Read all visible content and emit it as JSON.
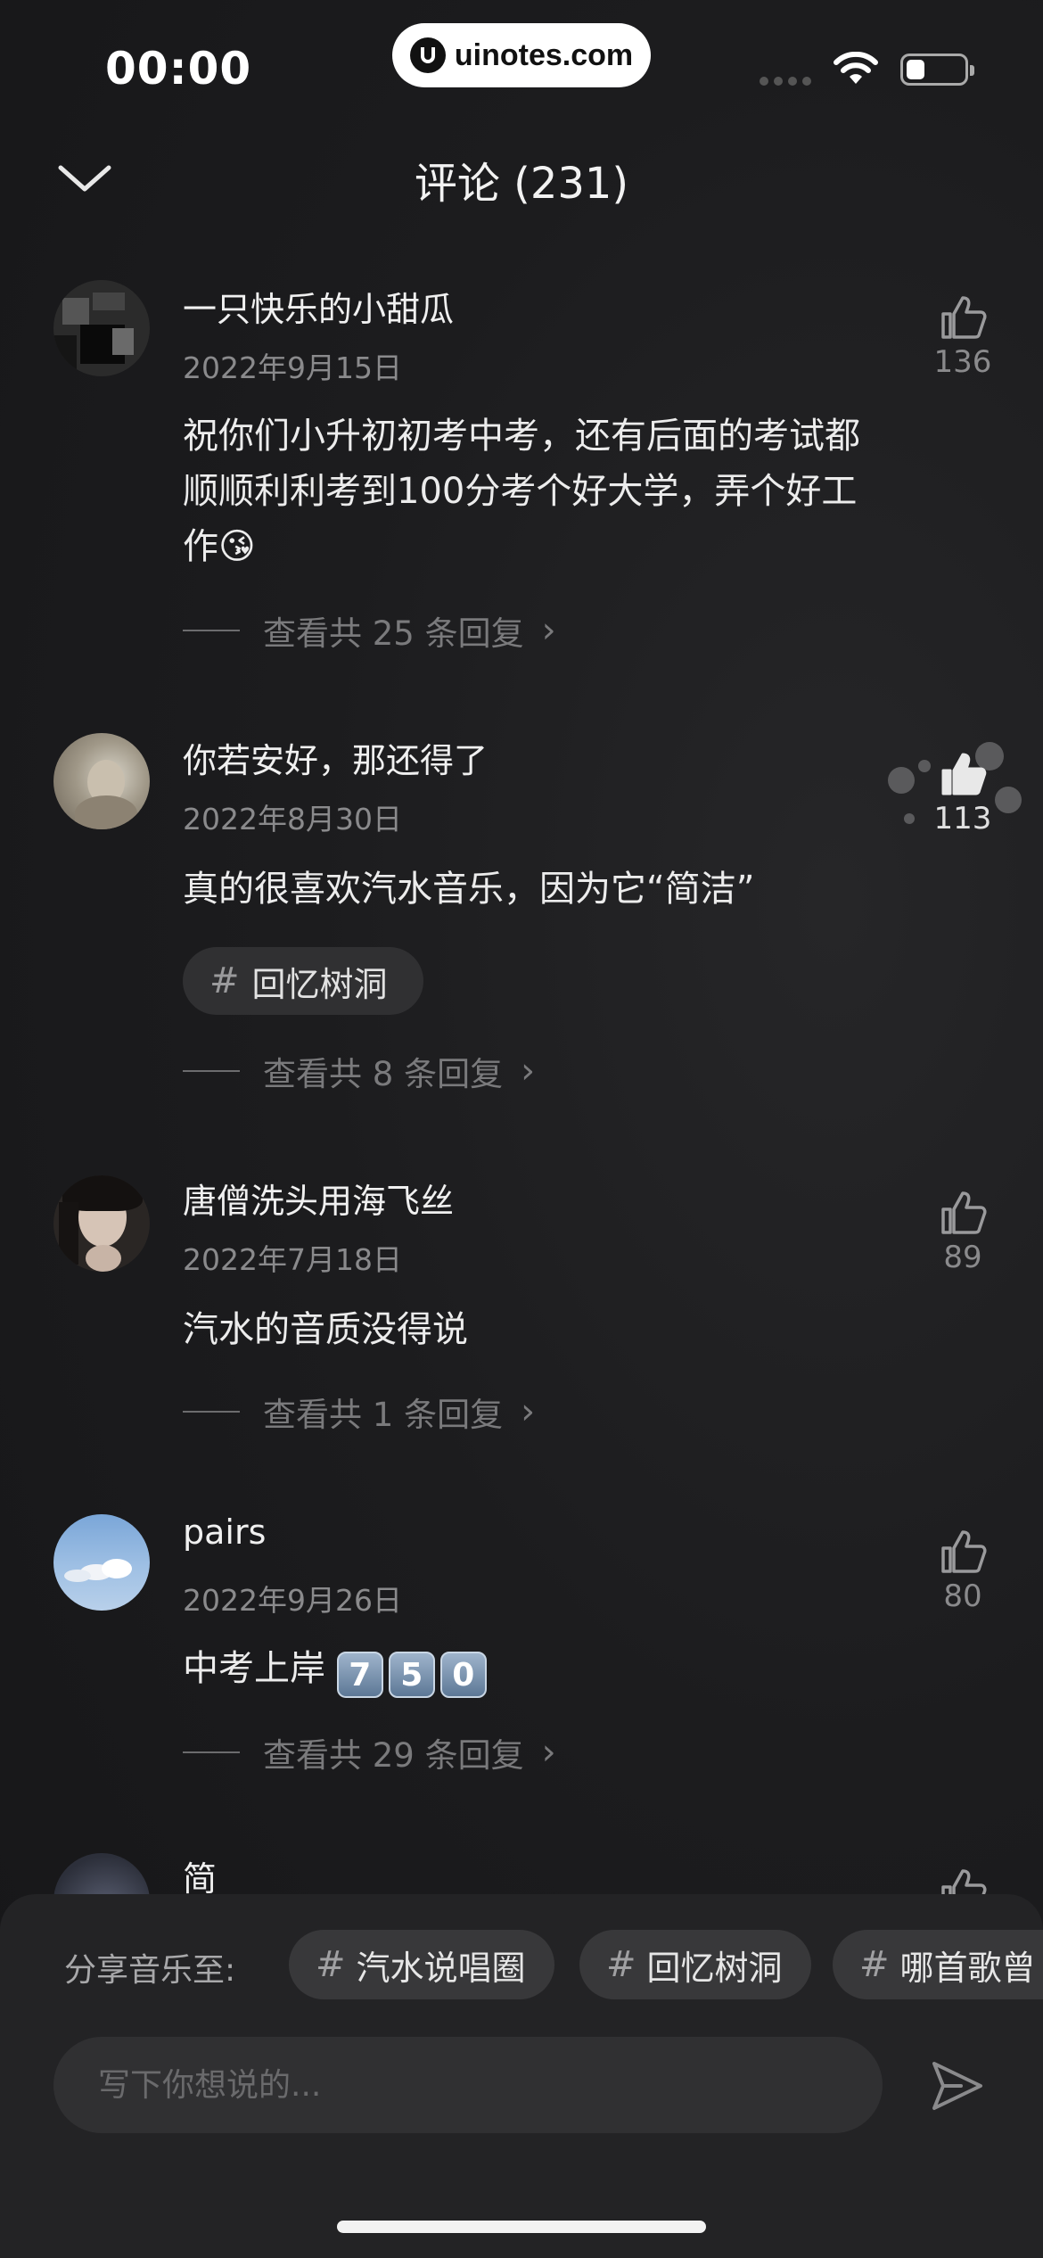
{
  "status_bar": {
    "time": "00:00",
    "watermark": "uinotes.com",
    "battery_level": 0.3
  },
  "header": {
    "title": "评论 (231)",
    "collapse_icon": "chevron-down-icon"
  },
  "comments": [
    {
      "name": "一只快乐的小甜瓜",
      "date": "2022年9月15日",
      "text": "祝你们小升初初考中考，还有后面的考试都顺顺利利考到100分考个好大学，弄个好工作😘",
      "likes": "136",
      "replies": "查看共 25 条回复"
    },
    {
      "name": "你若安好，那还得了",
      "date": "2022年8月30日",
      "text": "真的很喜欢汽水音乐，因为它“简洁”",
      "tag": "回忆树洞",
      "likes": "113",
      "liked": true,
      "replies": "查看共 8 条回复"
    },
    {
      "name": "唐僧洗头用海飞丝",
      "date": "2022年7月18日",
      "text": "汽水的音质没得说",
      "likes": "89",
      "replies": "查看共 1 条回复"
    },
    {
      "name": "pairs",
      "date": "2022年9月26日",
      "text": "中考上岸",
      "keycaps": [
        "7",
        "5",
        "0"
      ],
      "likes": "80",
      "replies": "查看共 29 条回复"
    },
    {
      "name": "简"
    }
  ],
  "share": {
    "label": "分享音乐至:",
    "chips": [
      "汽水说唱圈",
      "回忆树洞",
      "哪首歌曾"
    ]
  },
  "input": {
    "placeholder": "写下你想说的..."
  },
  "colors": {
    "background": "#1b1b1d",
    "sheet": "#232325",
    "muted_text": "#8a8a8c"
  }
}
